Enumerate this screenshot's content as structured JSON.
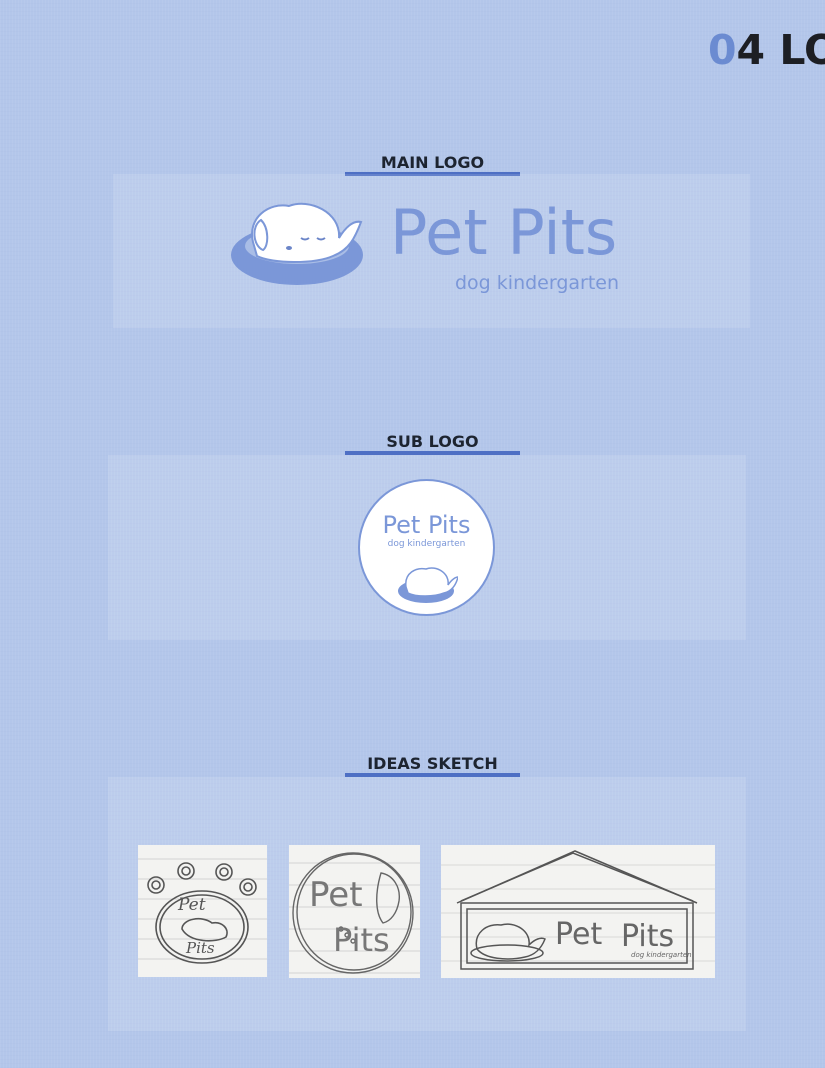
{
  "heading": {
    "number_light": "0",
    "number_dark": "4 LO"
  },
  "sections": {
    "main_logo": {
      "title": "MAIN LOGO"
    },
    "sub_logo": {
      "title": "SUB LOGO"
    },
    "ideas_sketch": {
      "title": "IDEAS SKETCH"
    }
  },
  "logo": {
    "name": "Pet Pits",
    "tagline": "dog kindergarten"
  },
  "sketches": [
    {
      "text_top": "Pet",
      "text_bottom": "Pits"
    },
    {
      "text_top": "Pet",
      "text_bottom": "Pits"
    },
    {
      "text_left": "Pet",
      "text_right": "Pits",
      "tagline": "dog kindergarten"
    }
  ],
  "colors": {
    "background": "#b3c6ea",
    "accent": "#7b97d8",
    "underline": "#4e6fc4",
    "title": "#1d2430"
  }
}
